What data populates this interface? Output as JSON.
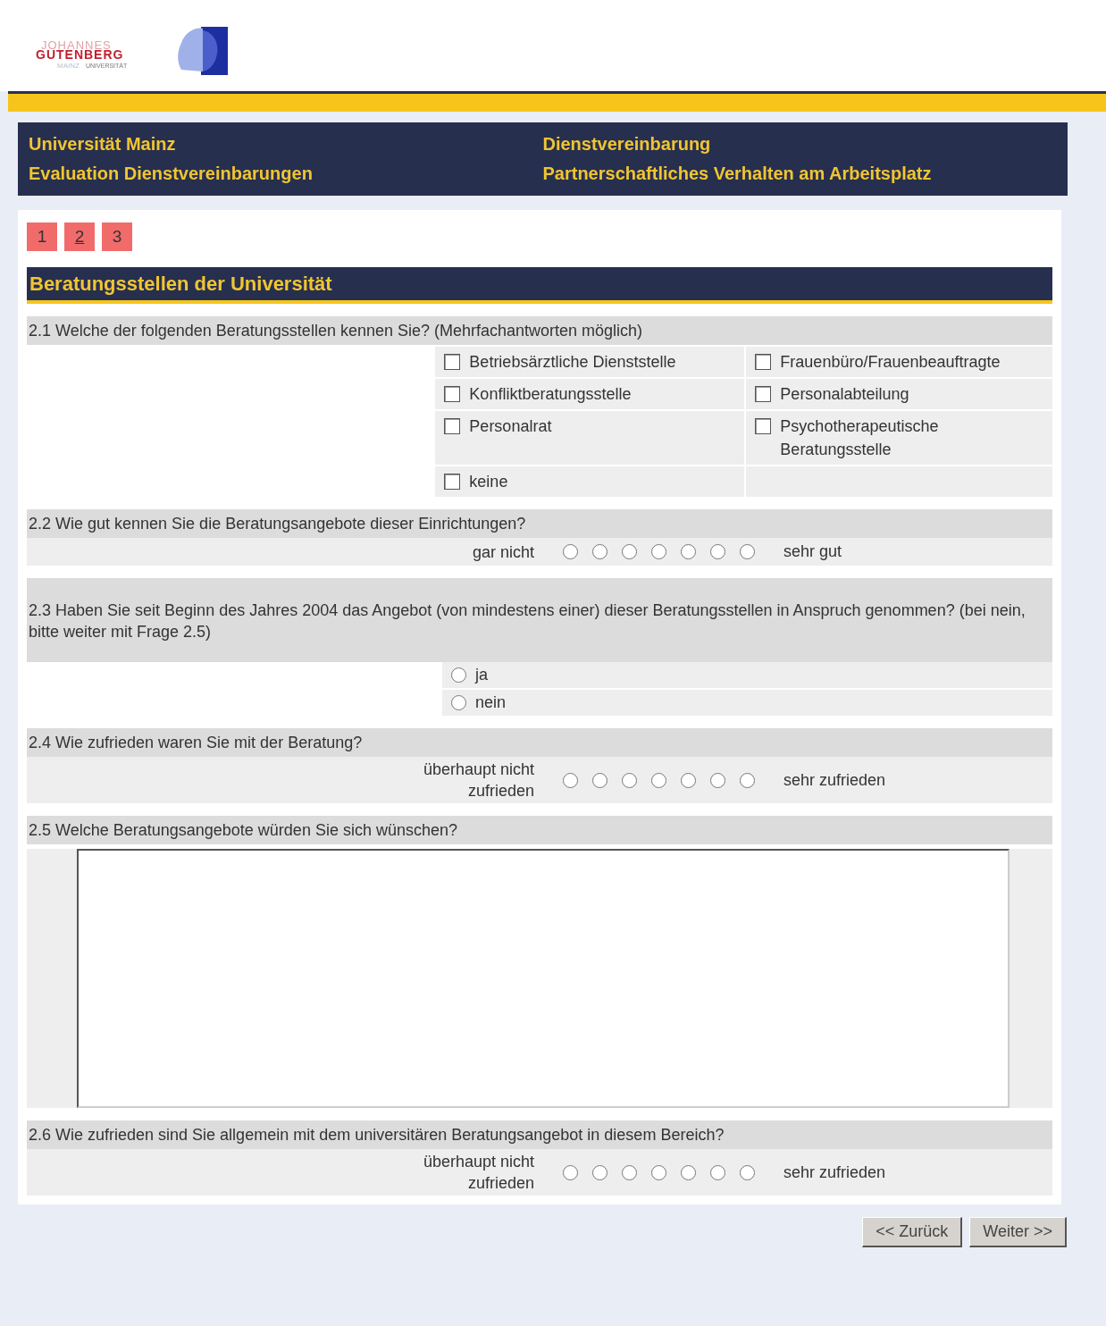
{
  "logo": {
    "top": "JOHANNES",
    "main": "GUTENBERG",
    "side": "UNIVERSITÄT",
    "bottom": "MAINZ"
  },
  "header": {
    "left": [
      "Universität Mainz",
      "Evaluation Dienstvereinbarungen"
    ],
    "right": [
      "Dienstvereinbarung",
      "Partnerschaftliches Verhalten am Arbeitsplatz"
    ]
  },
  "pages": [
    {
      "label": "1",
      "selected": false
    },
    {
      "label": "2",
      "selected": true
    },
    {
      "label": "3",
      "selected": false
    }
  ],
  "section_title": "Beratungsstellen der Universität",
  "questions": [
    {
      "kind": "checkbox_grid",
      "title": "2.1 Welche der folgenden Beratungsstellen kennen Sie? (Mehrfachantworten möglich)",
      "options": [
        {
          "label": "Betriebsärztliche Dienststelle",
          "checked": false
        },
        {
          "label": "Frauenbüro/Frauenbeauftragte",
          "checked": false
        },
        {
          "label": "Konfliktberatungsstelle",
          "checked": false
        },
        {
          "label": "Personalabteilung",
          "checked": false
        },
        {
          "label": "Personalrat",
          "checked": false
        },
        {
          "label": "Psychotherapeutische Beratungsstelle",
          "checked": false
        },
        {
          "label": "keine",
          "checked": false
        }
      ]
    },
    {
      "kind": "scale",
      "title": "2.2 Wie gut kennen Sie die Beratungsangebote dieser Einrichtungen?",
      "low": "gar nicht",
      "high": "sehr gut",
      "points": [
        {
          "selected": false
        },
        {
          "selected": false
        },
        {
          "selected": false
        },
        {
          "selected": false
        },
        {
          "selected": false
        },
        {
          "selected": false
        },
        {
          "selected": false
        }
      ]
    },
    {
      "kind": "radio",
      "title": "2.3 Haben Sie seit Beginn des Jahres 2004 das Angebot (von mindestens einer) dieser Beratungsstellen in Anspruch genommen? (bei nein, bitte weiter mit Frage 2.5)",
      "options": [
        {
          "label": "ja",
          "selected": false
        },
        {
          "label": "nein",
          "selected": false
        }
      ]
    },
    {
      "kind": "scale",
      "title": "2.4 Wie zufrieden waren Sie mit der Beratung?",
      "low": "überhaupt nicht zufrieden",
      "high": "sehr zufrieden",
      "points": [
        {
          "selected": false
        },
        {
          "selected": false
        },
        {
          "selected": false
        },
        {
          "selected": false
        },
        {
          "selected": false
        },
        {
          "selected": false
        },
        {
          "selected": false
        }
      ]
    },
    {
      "kind": "text",
      "title": "2.5 Welche Beratungsangebote würden Sie sich wünschen?"
    },
    {
      "kind": "scale",
      "title": "2.6 Wie zufrieden sind Sie allgemein mit dem universitären Beratungsangebot in diesem Bereich?",
      "low": "überhaupt nicht zufrieden",
      "high": "sehr zufrieden",
      "points": [
        {
          "selected": false
        },
        {
          "selected": false
        },
        {
          "selected": false
        },
        {
          "selected": false
        },
        {
          "selected": false
        },
        {
          "selected": false
        },
        {
          "selected": false
        }
      ]
    }
  ],
  "buttons": [
    "<< Zurück",
    "Weiter >>"
  ]
}
